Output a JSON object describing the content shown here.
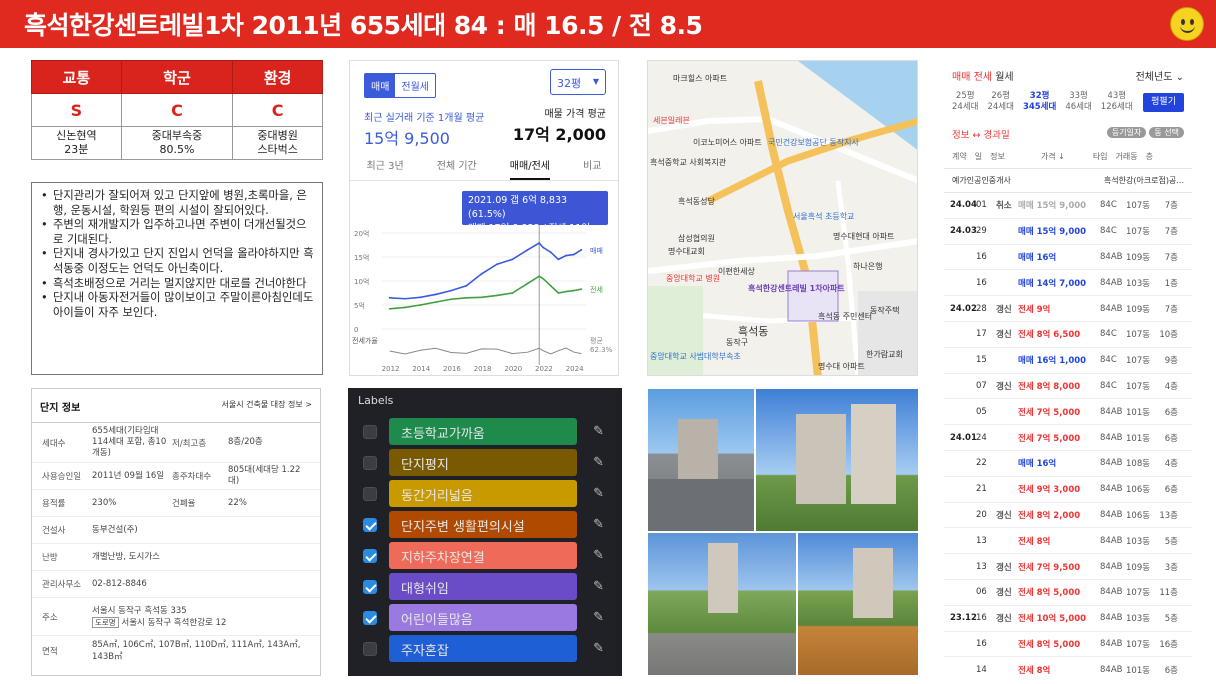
{
  "header": {
    "title": "흑석한강센트레빌1차  2011년  655세대  84 : 매 16.5 / 전 8.5",
    "bg_color": "#e02a20",
    "icon": "smiley-icon"
  },
  "grade": {
    "headers": [
      "교통",
      "학군",
      "환경"
    ],
    "values": [
      "S",
      "C",
      "C"
    ],
    "subs": [
      [
        "신논현역",
        "23분"
      ],
      [
        "중대부속중",
        "80.5%"
      ],
      [
        "중대병원",
        "스타벅스"
      ]
    ]
  },
  "notes": [
    "단지관리가 잘되어져 있고 단지앞에 병원,초록마을, 은행, 운동시설, 학원등 편의 시설이 잘되어있다.",
    "주변의 재개발지가 입주하고나면 주변이 더개선될것으로 기대된다.",
    "단지내 경사가있고 단지 진입시 언덕을 올라야하지만 흑석동중 이정도는 언덕도 아닌축이다.",
    "흑석초배정으로 거리는 멀지않지만 대로를 건너야한다",
    "단지내 아동자전거들이 많이보이고 주말이른아침인데도 아이들이 자주 보인다."
  ],
  "price_chart": {
    "tabs": [
      "매매",
      "전월세"
    ],
    "select": "32평",
    "left_label": "최근 실거래 기준 1개월 평균",
    "left_value": "15억 9,500",
    "right_label": "매물 가격 평균",
    "right_value": "17억 2,000",
    "nav": [
      "최근 3년",
      "전체 기간",
      "매매/전세",
      "비교"
    ],
    "tooltip_line1": "2021.09  갭 6억 8,833 (61.5%)",
    "tooltip_line2": "매매 17억 8,833 / 전세 11억",
    "y_ticks": [
      "20억",
      "15억",
      "10억",
      "5억",
      "0"
    ],
    "x_ticks": [
      "2012",
      "2014",
      "2016",
      "2018",
      "2020",
      "2022",
      "2024"
    ],
    "series_labels": [
      "매매",
      "전세"
    ],
    "ratio_label": "전세가율",
    "ratio_side": [
      "평균",
      "62.3%"
    ],
    "colors": {
      "sale": "#3b5bdb",
      "jeonse": "#40a040",
      "ratio": "#888888"
    }
  },
  "chart_data": {
    "type": "line",
    "x": [
      2012,
      2013,
      2014,
      2015,
      2016,
      2017,
      2018,
      2019,
      2020,
      2021,
      2021.75,
      2022,
      2022.5,
      2023,
      2023.5,
      2024,
      2024.5
    ],
    "series": [
      {
        "name": "매매",
        "values": [
          6.5,
          6.3,
          6.6,
          7.2,
          8.0,
          9.0,
          11.5,
          13.5,
          14.5,
          16.5,
          17.9,
          17.0,
          16.0,
          14.5,
          15.3,
          15.5,
          16.5
        ]
      },
      {
        "name": "전세",
        "values": [
          4.2,
          4.5,
          5.0,
          5.6,
          6.2,
          6.5,
          6.6,
          7.0,
          7.5,
          9.5,
          11.0,
          10.5,
          9.0,
          7.5,
          7.8,
          8.0,
          8.3
        ]
      }
    ],
    "ylim": [
      0,
      20
    ],
    "y_ticks": [
      "20억",
      "15억",
      "10억",
      "5억",
      "0"
    ],
    "x_ticks": [
      "2012",
      "2014",
      "2016",
      "2018",
      "2020",
      "2022",
      "2024"
    ]
  },
  "map": {
    "labels": [
      "마크힐스 아파트",
      "세븐일레븐",
      "이코노미어스 아파트",
      "흑석중학교 사회복지관",
      "국민건강보험공단 동작지사",
      "흑석동성당",
      "서울흑석 초등학교",
      "명수대현대 아파트",
      "흑석동 주민센터",
      "중앙대학교 병원",
      "흑석동",
      "흑석한강센트레빌 1차아파트",
      "한가람교회",
      "명수대 아파트",
      "하나은행",
      "중앙대학교 사범대학부속초",
      "삼성협의원",
      "이편한세상",
      "명수대교회",
      "동작구",
      "동작주택"
    ]
  },
  "tx": {
    "tabs": [
      "매매",
      "전세",
      "월세"
    ],
    "year_filter": "전체년도",
    "sizes": [
      {
        "p": "25평",
        "h": "24세대"
      },
      {
        "p": "26평",
        "h": "24세대"
      },
      {
        "p": "32평",
        "h": "345세대"
      },
      {
        "p": "33평",
        "h": "46세대"
      },
      {
        "p": "43평",
        "h": "126세대"
      }
    ],
    "size_button": "평펼기",
    "info_left": "정보 ↔ 경과일",
    "chips": [
      "등기일자",
      "동 선택"
    ],
    "cols": [
      "계약",
      "일",
      "정보",
      "가격 ↓",
      "타입",
      "거래동",
      "층"
    ],
    "agents": [
      "예가인공인중개사",
      "흑석한강(아크로점)공..."
    ],
    "rows": [
      {
        "ym": "24.04",
        "d": "01",
        "f": "취소",
        "p": "매매 15억 9,000",
        "k": "c",
        "t": "84C",
        "dong": "107동",
        "fl": "7층"
      },
      {
        "ym": "24.03",
        "d": "29",
        "f": "",
        "p": "매매 15억 9,000",
        "k": "m",
        "t": "84C",
        "dong": "107동",
        "fl": "7층"
      },
      {
        "ym": "",
        "d": "16",
        "f": "",
        "p": "매매 16억",
        "k": "m",
        "t": "84AB",
        "dong": "109동",
        "fl": "7층"
      },
      {
        "ym": "",
        "d": "16",
        "f": "",
        "p": "매매 14억 7,000",
        "k": "m",
        "t": "84AB",
        "dong": "103동",
        "fl": "1층"
      },
      {
        "ym": "24.02",
        "d": "28",
        "f": "갱신",
        "p": "전세 9억",
        "k": "j",
        "t": "84AB",
        "dong": "109동",
        "fl": "7층"
      },
      {
        "ym": "",
        "d": "17",
        "f": "갱신",
        "p": "전세 8억 6,500",
        "k": "j",
        "t": "84C",
        "dong": "107동",
        "fl": "10층"
      },
      {
        "ym": "",
        "d": "15",
        "f": "",
        "p": "매매 16억 1,000",
        "k": "m",
        "t": "84C",
        "dong": "107동",
        "fl": "9층"
      },
      {
        "ym": "",
        "d": "07",
        "f": "갱신",
        "p": "전세 8억 8,000",
        "k": "j",
        "t": "84C",
        "dong": "107동",
        "fl": "4층"
      },
      {
        "ym": "",
        "d": "05",
        "f": "",
        "p": "전세 7억 5,000",
        "k": "j",
        "t": "84AB",
        "dong": "101동",
        "fl": "6층"
      },
      {
        "ym": "24.01",
        "d": "24",
        "f": "",
        "p": "전세 7억 5,000",
        "k": "j",
        "t": "84AB",
        "dong": "101동",
        "fl": "6층"
      },
      {
        "ym": "",
        "d": "22",
        "f": "",
        "p": "매매 16억",
        "k": "m",
        "t": "84AB",
        "dong": "108동",
        "fl": "4층"
      },
      {
        "ym": "",
        "d": "21",
        "f": "",
        "p": "전세 9억 3,000",
        "k": "j",
        "t": "84AB",
        "dong": "106동",
        "fl": "6층"
      },
      {
        "ym": "",
        "d": "20",
        "f": "갱신",
        "p": "전세 8억 2,000",
        "k": "j",
        "t": "84AB",
        "dong": "106동",
        "fl": "13층"
      },
      {
        "ym": "",
        "d": "13",
        "f": "",
        "p": "전세 8억",
        "k": "j",
        "t": "84AB",
        "dong": "103동",
        "fl": "5층"
      },
      {
        "ym": "",
        "d": "13",
        "f": "갱신",
        "p": "전세 7억 9,500",
        "k": "j",
        "t": "84AB",
        "dong": "109동",
        "fl": "3층"
      },
      {
        "ym": "",
        "d": "06",
        "f": "갱신",
        "p": "전세 8억 5,000",
        "k": "j",
        "t": "84AB",
        "dong": "107동",
        "fl": "11층"
      },
      {
        "ym": "23.12",
        "d": "16",
        "f": "갱신",
        "p": "전세 10억 5,000",
        "k": "j",
        "t": "84AB",
        "dong": "103동",
        "fl": "5층"
      },
      {
        "ym": "",
        "d": "16",
        "f": "",
        "p": "전세 8억 5,000",
        "k": "j",
        "t": "84AB",
        "dong": "107동",
        "fl": "16층"
      },
      {
        "ym": "",
        "d": "14",
        "f": "",
        "p": "전세 8억",
        "k": "j",
        "t": "84AB",
        "dong": "101동",
        "fl": "6층"
      }
    ]
  },
  "complex_info": {
    "title": "단지 정보",
    "link": "서울시 건축물 대장 정보 >",
    "rows": [
      {
        "k": "세대수",
        "v": "655세대(기타임대 114세대 포함, 총10개동)",
        "k2": "저/최고층",
        "v2": "8층/20층"
      },
      {
        "k": "사용승인일",
        "v": "2011년 09월 16일",
        "k2": "총주차대수",
        "v2": "805대(세대당 1.22대)"
      },
      {
        "k": "용적률",
        "v": "230%",
        "k2": "건폐율",
        "v2": "22%"
      },
      {
        "k": "건설사",
        "v": "동부건설(주)",
        "k2": "",
        "v2": ""
      },
      {
        "k": "난방",
        "v": "개별난방, 도시가스",
        "k2": "",
        "v2": ""
      },
      {
        "k": "관리사무소",
        "v": "02-812-8846",
        "k2": "",
        "v2": ""
      }
    ],
    "addr_key": "주소",
    "addr1": "서울시 동작구 흑석동 335",
    "addr_tag": "도로명",
    "addr2": "서울시 동작구 흑석한강로 12",
    "area_key": "면적",
    "area": "85A㎡, 106C㎡, 107B㎡, 110D㎡, 111A㎡, 143A㎡, 143B㎡"
  },
  "labels": {
    "title": "Labels",
    "items": [
      {
        "text": "초등학교가까움",
        "color": "#1e8a4c",
        "checked": false
      },
      {
        "text": "단지평지",
        "color": "#7a5a00",
        "checked": false
      },
      {
        "text": "동간거리넓음",
        "color": "#c99a00",
        "checked": false
      },
      {
        "text": "단지주변 생활편의시설",
        "color": "#b04a00",
        "checked": true
      },
      {
        "text": "지하주차장연결",
        "color": "#f06a5a",
        "checked": true
      },
      {
        "text": "대형쉬임",
        "color": "#6a4cc8",
        "checked": true
      },
      {
        "text": "어린이들많음",
        "color": "#9a7ae0",
        "checked": true
      },
      {
        "text": "주자혼잡",
        "color": "#1f5fd6",
        "checked": false
      }
    ]
  }
}
